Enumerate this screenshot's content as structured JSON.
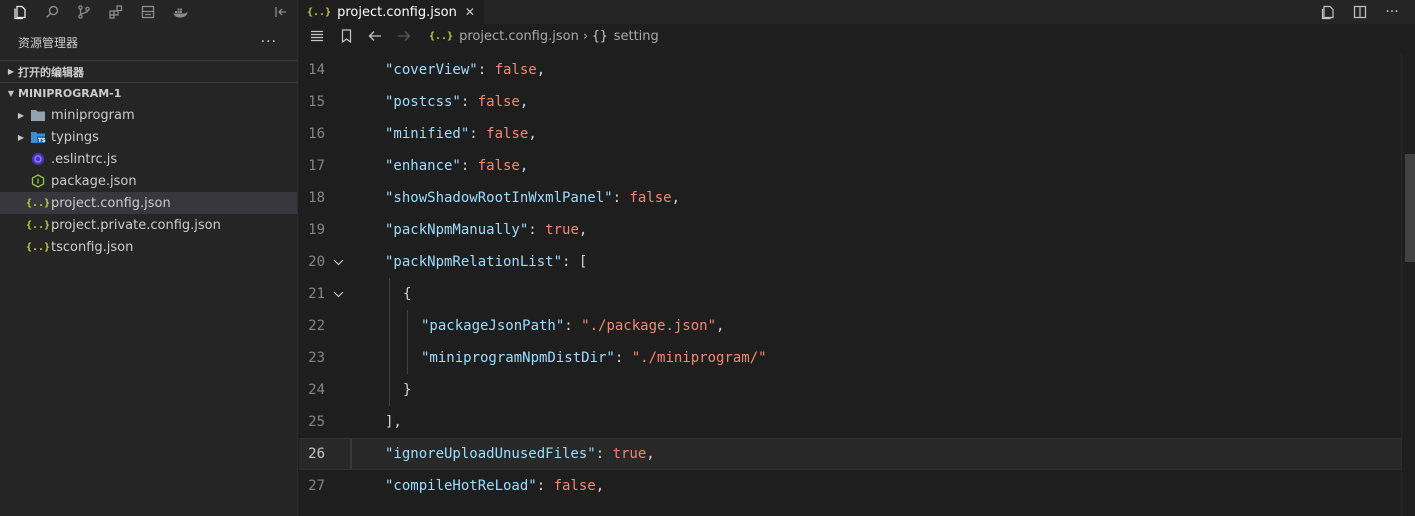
{
  "sidebar": {
    "title": "资源管理器",
    "more": "···",
    "sections": [
      {
        "label": "打开的编辑器",
        "expanded": false
      },
      {
        "label": "MINIPROGRAM-1",
        "expanded": true
      }
    ],
    "tree": [
      {
        "name": "miniprogram",
        "type": "folder",
        "icon": "folder-icon"
      },
      {
        "name": "typings",
        "type": "folder",
        "icon": "typescript-folder-icon"
      },
      {
        "name": ".eslintrc.js",
        "type": "file",
        "icon": "eslint-icon"
      },
      {
        "name": "package.json",
        "type": "file",
        "icon": "node-package-icon"
      },
      {
        "name": "project.config.json",
        "type": "file",
        "icon": "json-braces-icon",
        "selected": true
      },
      {
        "name": "project.private.config.json",
        "type": "file",
        "icon": "json-braces-icon"
      },
      {
        "name": "tsconfig.json",
        "type": "file",
        "icon": "json-braces-icon"
      }
    ]
  },
  "editor": {
    "tab": {
      "label": "project.config.json",
      "close": "✕"
    },
    "breadcrumb": {
      "file": "project.config.json",
      "separator": "›",
      "symbol_icon": "{}",
      "symbol": "setting"
    },
    "lines": [
      {
        "num": "14",
        "indent": 0,
        "tokens": [
          [
            "k",
            "\"coverView\""
          ],
          [
            "p",
            ": "
          ],
          [
            "b",
            "false"
          ],
          [
            "p",
            ","
          ]
        ]
      },
      {
        "num": "15",
        "indent": 0,
        "tokens": [
          [
            "k",
            "\"postcss\""
          ],
          [
            "p",
            ": "
          ],
          [
            "b",
            "false"
          ],
          [
            "p",
            ","
          ]
        ]
      },
      {
        "num": "16",
        "indent": 0,
        "tokens": [
          [
            "k",
            "\"minified\""
          ],
          [
            "p",
            ": "
          ],
          [
            "b",
            "false"
          ],
          [
            "p",
            ","
          ]
        ]
      },
      {
        "num": "17",
        "indent": 0,
        "tokens": [
          [
            "k",
            "\"enhance\""
          ],
          [
            "p",
            ": "
          ],
          [
            "b",
            "false"
          ],
          [
            "p",
            ","
          ]
        ]
      },
      {
        "num": "18",
        "indent": 0,
        "tokens": [
          [
            "k",
            "\"showShadowRootInWxmlPanel\""
          ],
          [
            "p",
            ": "
          ],
          [
            "b",
            "false"
          ],
          [
            "p",
            ","
          ]
        ]
      },
      {
        "num": "19",
        "indent": 0,
        "tokens": [
          [
            "k",
            "\"packNpmManually\""
          ],
          [
            "p",
            ": "
          ],
          [
            "b",
            "true"
          ],
          [
            "p",
            ","
          ]
        ]
      },
      {
        "num": "20",
        "indent": 0,
        "fold": true,
        "tokens": [
          [
            "k",
            "\"packNpmRelationList\""
          ],
          [
            "p",
            ": ["
          ]
        ]
      },
      {
        "num": "21",
        "indent": 1,
        "fold": true,
        "tokens": [
          [
            "p",
            "{"
          ]
        ]
      },
      {
        "num": "22",
        "indent": 2,
        "tokens": [
          [
            "k",
            "\"packageJsonPath\""
          ],
          [
            "p",
            ": "
          ],
          [
            "s",
            "\"./package.json\""
          ],
          [
            "p",
            ","
          ]
        ]
      },
      {
        "num": "23",
        "indent": 2,
        "tokens": [
          [
            "k",
            "\"miniprogramNpmDistDir\""
          ],
          [
            "p",
            ": "
          ],
          [
            "s",
            "\"./miniprogram/\""
          ]
        ]
      },
      {
        "num": "24",
        "indent": 1,
        "tokens": [
          [
            "p",
            "}"
          ]
        ]
      },
      {
        "num": "25",
        "indent": 0,
        "tokens": [
          [
            "p",
            "],"
          ]
        ]
      },
      {
        "num": "26",
        "indent": 0,
        "current": true,
        "tokens": [
          [
            "k",
            "\"ignoreUploadUnusedFiles\""
          ],
          [
            "p",
            ": "
          ],
          [
            "b",
            "true"
          ],
          [
            "p",
            ","
          ]
        ]
      },
      {
        "num": "27",
        "indent": 0,
        "tokens": [
          [
            "k",
            "\"compileHotReLoad\""
          ],
          [
            "p",
            ": "
          ],
          [
            "b",
            "false"
          ],
          [
            "p",
            ","
          ]
        ]
      }
    ]
  },
  "colors": {
    "key": "#9cdcfe",
    "value": "#f48771",
    "punct": "#d4d4d4",
    "json_icon": "#cbcb41"
  }
}
